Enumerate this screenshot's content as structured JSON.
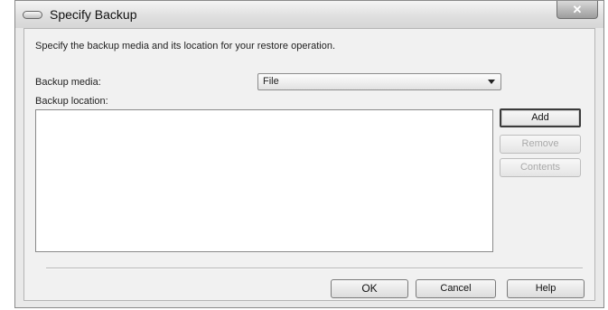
{
  "window": {
    "title": "Specify Backup",
    "close_symbol": "✕"
  },
  "dialog": {
    "intro": "Specify the backup media and its location for your restore operation.",
    "backup_media_label": "Backup media:",
    "backup_media_value": "File",
    "backup_location_label": "Backup location:",
    "location_items": []
  },
  "buttons": {
    "add": "Add",
    "remove": "Remove",
    "contents": "Contents",
    "ok": "OK",
    "cancel": "Cancel",
    "help": "Help"
  },
  "icons": {
    "app": "window-icon",
    "close": "close-icon",
    "dropdown": "chevron-down-icon"
  }
}
